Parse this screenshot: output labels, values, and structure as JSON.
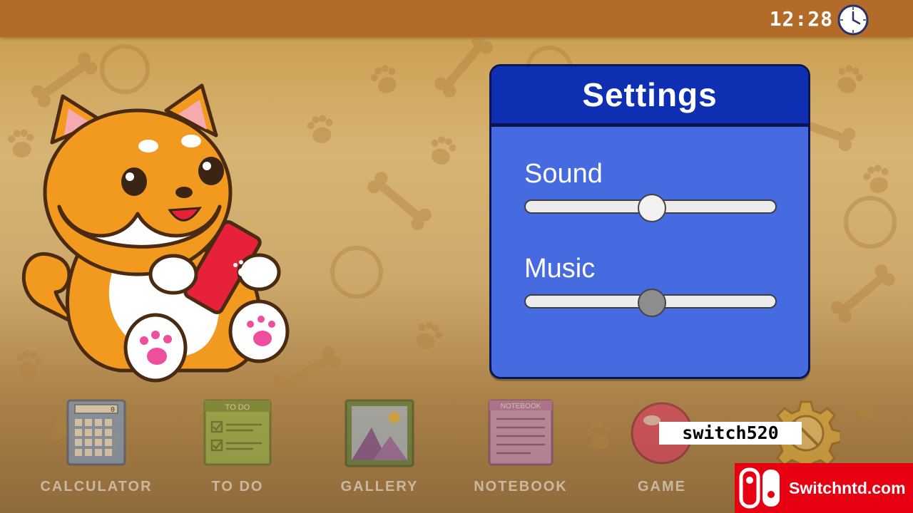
{
  "status_bar": {
    "time": "12:28",
    "icon": "clock-icon"
  },
  "settings": {
    "title": "Settings",
    "sound": {
      "label": "Sound",
      "level": 0.5
    },
    "music": {
      "label": "Music",
      "level": 0.5
    }
  },
  "dock": {
    "items": [
      {
        "label": "CALCULATOR",
        "icon": "calculator-icon"
      },
      {
        "label": "TO DO",
        "icon": "todo-icon",
        "icon_text": "TO DO"
      },
      {
        "label": "GALLERY",
        "icon": "gallery-icon"
      },
      {
        "label": "NOTEBOOK",
        "icon": "notebook-icon",
        "icon_text": "NOTEBOOK"
      },
      {
        "label": "GAME",
        "icon": "game-icon"
      },
      {
        "label": "",
        "icon": "gear-icon"
      }
    ],
    "calculator_display": "0"
  },
  "watermarks": {
    "text": "switch520",
    "site": "Switchntd.com"
  },
  "colors": {
    "topbar": "#b36b2a",
    "settings_header": "#0f2fb3",
    "settings_body": "#466ae0",
    "badge": "#e60012"
  }
}
